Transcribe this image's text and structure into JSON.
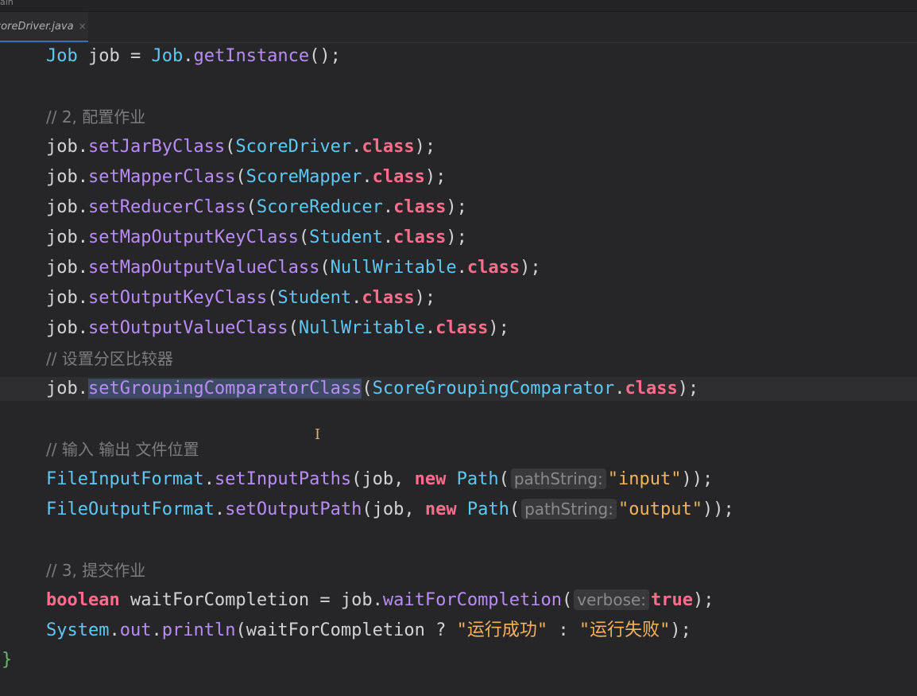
{
  "window": {
    "title_fragment": "ain"
  },
  "tab": {
    "label": "coreDriver.java",
    "close_glyph": "×"
  },
  "code": {
    "l1": {
      "type1": "Job",
      "var": " job = ",
      "type2": "Job",
      "dot": ".",
      "method": "getInstance",
      "tail": "();"
    },
    "l2": {
      "comment": "// 2, 配置作业"
    },
    "l3": {
      "obj": "job.",
      "method": "setJarByClass",
      "open": "(",
      "type": "ScoreDriver",
      "dot": ".",
      "kw": "class",
      "close": ");"
    },
    "l4": {
      "obj": "job.",
      "method": "setMapperClass",
      "open": "(",
      "type": "ScoreMapper",
      "dot": ".",
      "kw": "class",
      "close": ");"
    },
    "l5": {
      "obj": "job.",
      "method": "setReducerClass",
      "open": "(",
      "type": "ScoreReducer",
      "dot": ".",
      "kw": "class",
      "close": ");"
    },
    "l6": {
      "obj": "job.",
      "method": "setMapOutputKeyClass",
      "open": "(",
      "type": "Student",
      "dot": ".",
      "kw": "class",
      "close": ");"
    },
    "l7": {
      "obj": "job.",
      "method": "setMapOutputValueClass",
      "open": "(",
      "type": "NullWritable",
      "dot": ".",
      "kw": "class",
      "close": ");"
    },
    "l8": {
      "obj": "job.",
      "method": "setOutputKeyClass",
      "open": "(",
      "type": "Student",
      "dot": ".",
      "kw": "class",
      "close": ");"
    },
    "l9": {
      "obj": "job.",
      "method": "setOutputValueClass",
      "open": "(",
      "type": "NullWritable",
      "dot": ".",
      "kw": "class",
      "close": ");"
    },
    "l10": {
      "comment": "// 设置分区比较器"
    },
    "l11": {
      "obj": "job.",
      "method": "setGroupingComparatorClass",
      "open": "(",
      "type": "ScoreGroupingComparator",
      "dot": ".",
      "kw": "class",
      "close": ");"
    },
    "l12": {
      "comment": "// 输入 输出 文件位置"
    },
    "l13": {
      "type1": "FileInputFormat",
      "dot": ".",
      "method": "setInputPaths",
      "args": "(job, ",
      "kw": "new",
      "sp": " ",
      "type2": "Path",
      "open": "(",
      "hint": "pathString:",
      "str": "\"input\"",
      "close": "));"
    },
    "l14": {
      "type1": "FileOutputFormat",
      "dot": ".",
      "method": "setOutputPath",
      "args": "(job, ",
      "kw": "new",
      "sp": " ",
      "type2": "Path",
      "open": "(",
      "hint": "pathString:",
      "str": "\"output\"",
      "close": "));"
    },
    "l15": {
      "comment": "// 3, 提交作业"
    },
    "l16": {
      "kw": "boolean",
      "var": " waitForCompletion = job.",
      "method": "waitForCompletion",
      "open": "(",
      "hint": "verbose:",
      "kw2": "true",
      "close": ");"
    },
    "l17": {
      "type": "System",
      "dot1": ".",
      "field": "out",
      "dot2": ".",
      "method": "println",
      "args": "(waitForCompletion ? ",
      "str1": "\"运行成功\"",
      "sep": " : ",
      "str2": "\"运行失败\"",
      "close": ");"
    },
    "closing_brace": "}"
  },
  "colors": {
    "background": "#262628",
    "keyword": "#ff6d8c",
    "type": "#5ec8f5",
    "method": "#b98df5",
    "string": "#f5b35b",
    "comment": "#7c7c7c",
    "selection": "#3c4a63"
  }
}
